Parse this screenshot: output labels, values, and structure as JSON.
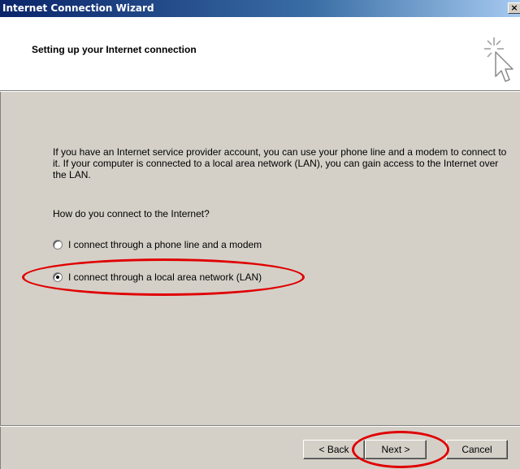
{
  "window": {
    "title": "Internet Connection Wizard",
    "close_glyph": "×"
  },
  "header": {
    "title": "Setting up your Internet connection",
    "icon": "wizard-cursor-sparkle-icon"
  },
  "body": {
    "intro": "If you have an Internet service provider account, you can use your phone line and a modem to connect to it. If your computer is connected to a local area network (LAN), you can gain access to the Internet over the LAN.",
    "question": "How do you connect to the Internet?",
    "options": [
      {
        "label": "I connect through a phone line and a modem",
        "checked": false
      },
      {
        "label": "I connect through a local area network (LAN)",
        "checked": true
      }
    ]
  },
  "buttons": {
    "back": "< Back",
    "next": "Next >",
    "cancel": "Cancel"
  },
  "annotations": {
    "highlight_color": "#e00000"
  }
}
